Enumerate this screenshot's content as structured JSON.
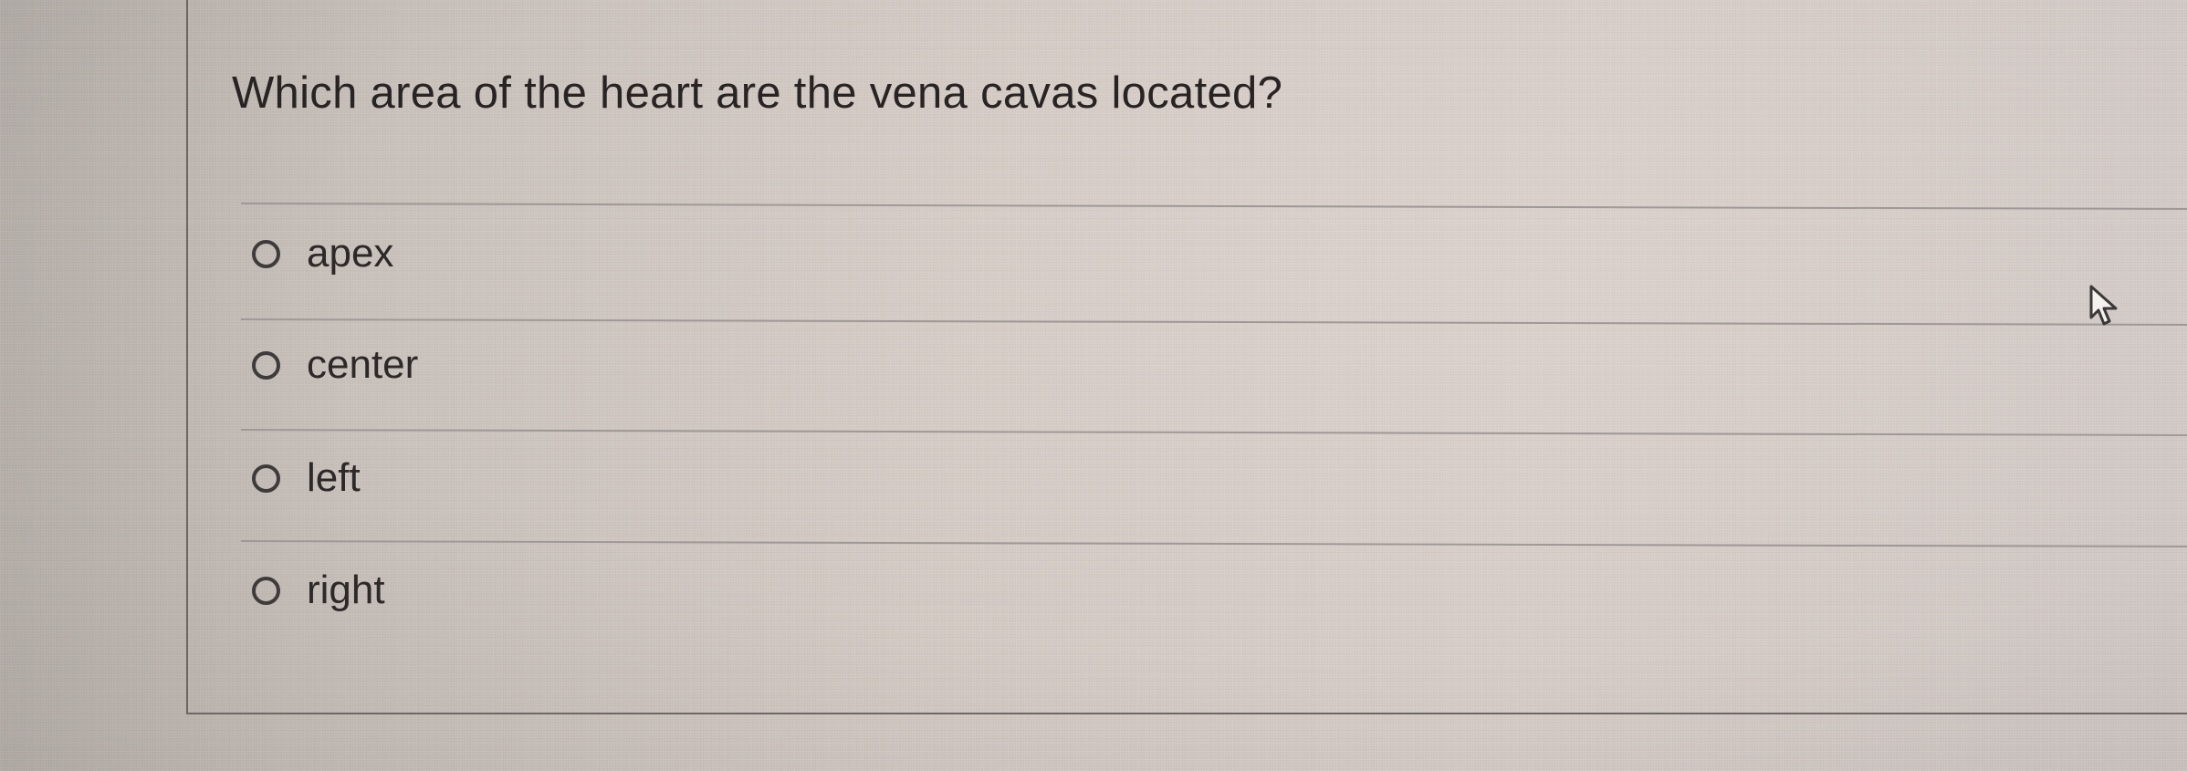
{
  "question": {
    "text": "Which area of the heart are the vena cavas located?"
  },
  "answers": [
    {
      "label": "apex",
      "selected": false
    },
    {
      "label": "center",
      "selected": false
    },
    {
      "label": "left",
      "selected": false
    },
    {
      "label": "right",
      "selected": false
    }
  ],
  "icons": {
    "radio": "radio-button-empty",
    "cursor": "pointer-hand-cursor"
  },
  "colors": {
    "background": "#d3cac5",
    "text": "#2a2727",
    "divider": "#9f9896",
    "panel_border": "#6d6866"
  }
}
